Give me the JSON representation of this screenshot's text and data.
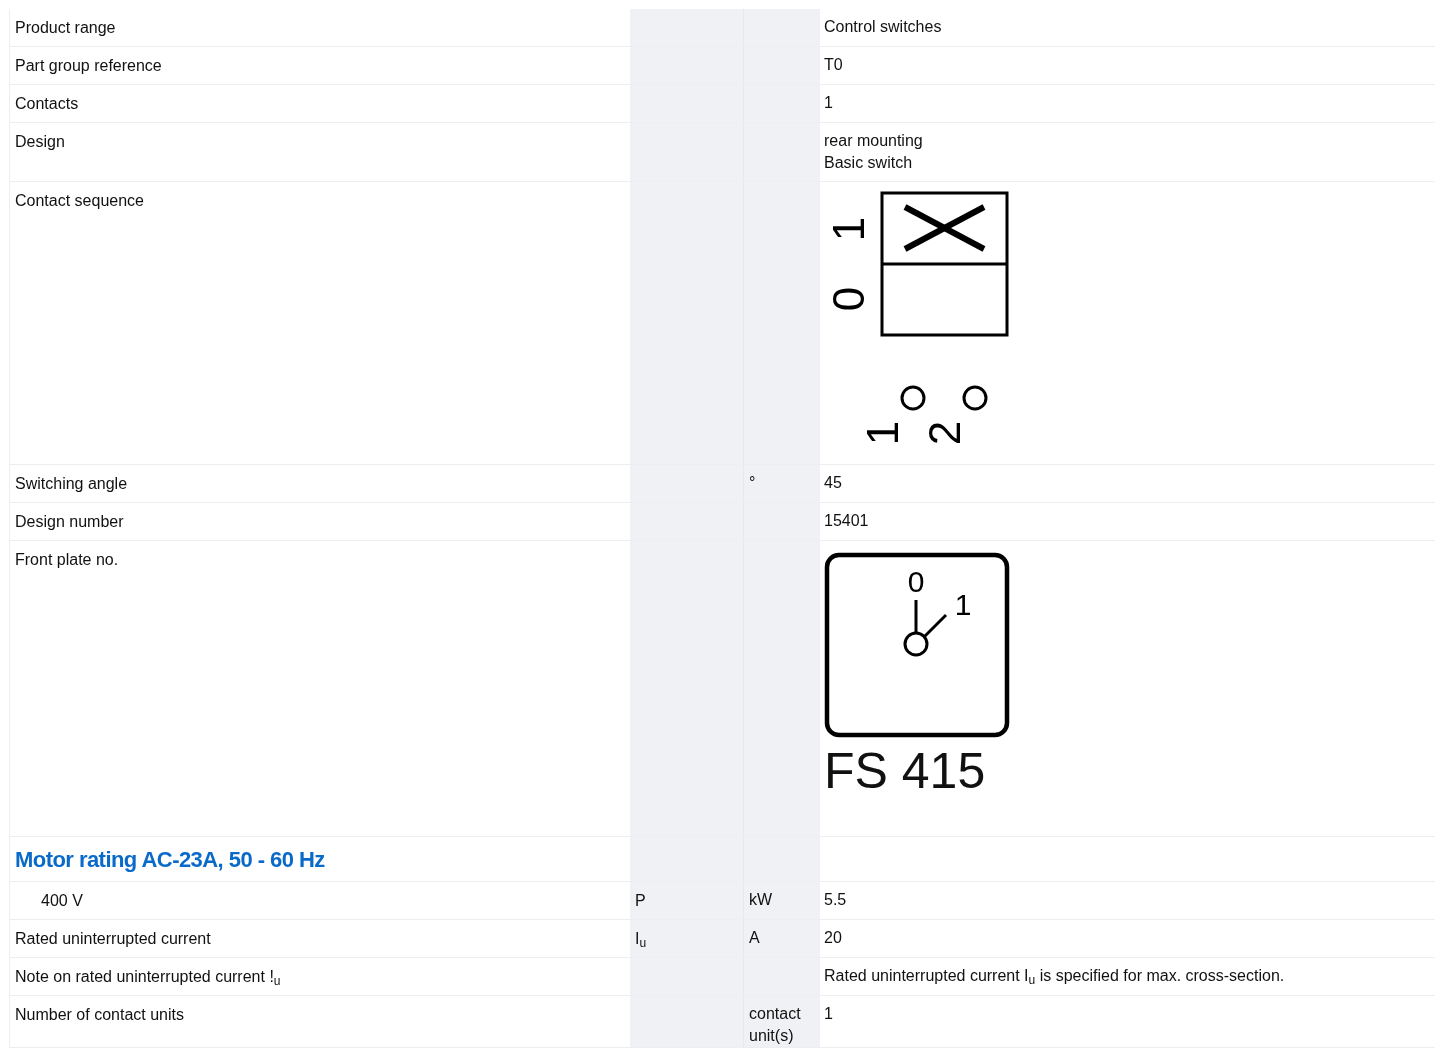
{
  "rows": [
    {
      "kind": "text",
      "label": "Product range",
      "symbol": "",
      "unit": "",
      "value": [
        "Control switches"
      ]
    },
    {
      "kind": "text",
      "label": "Part group reference",
      "symbol": "",
      "unit": "",
      "value": [
        "T0"
      ]
    },
    {
      "kind": "text",
      "label": "Contacts",
      "symbol": "",
      "unit": "",
      "value": [
        "1"
      ]
    },
    {
      "kind": "text",
      "label": "Design",
      "symbol": "",
      "unit": "",
      "value": [
        "rear mounting",
        "Basic switch"
      ]
    },
    {
      "kind": "contact-sequence",
      "label": "Contact sequence",
      "positions": [
        "1",
        "0"
      ],
      "terminals": [
        "1",
        "2"
      ]
    },
    {
      "kind": "text",
      "label": "Switching angle",
      "symbol": "",
      "unit": "°",
      "value": [
        "45"
      ]
    },
    {
      "kind": "text",
      "label": "Design number",
      "symbol": "",
      "unit": "",
      "value": [
        "15401"
      ]
    },
    {
      "kind": "front-plate",
      "label": "Front plate no.",
      "positions": [
        "0",
        "1"
      ],
      "caption": "FS 415"
    },
    {
      "kind": "heading",
      "label": "Motor rating AC-23A, 50 - 60 Hz"
    },
    {
      "kind": "text",
      "label": "400 V",
      "indented": true,
      "symbol": "P",
      "unit": "kW",
      "value": [
        "5.5"
      ]
    },
    {
      "kind": "text",
      "label": "Rated uninterrupted current",
      "symbol": "I$_{u}$",
      "unit": "A",
      "value": [
        "20"
      ]
    },
    {
      "kind": "text",
      "label": "Note on rated uninterrupted current !$_{u}$",
      "symbol": "",
      "unit": "",
      "value": [
        "Rated uninterrupted current I$_{u}$ is specified for max. cross-section."
      ]
    },
    {
      "kind": "text",
      "label": "Number of contact units",
      "symbol": "",
      "unit": "contact unit(s)",
      "value": [
        "1"
      ]
    }
  ]
}
